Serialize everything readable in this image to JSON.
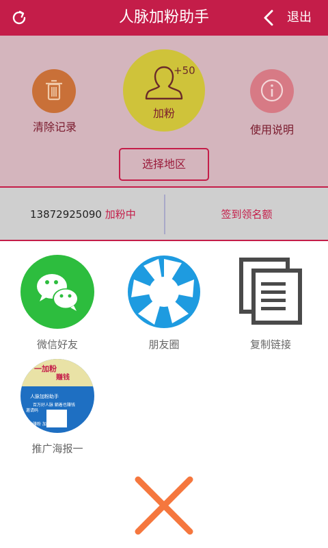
{
  "app": {
    "title": "人脉加粉助手",
    "exit_label": "退出"
  },
  "panel": {
    "clear_label": "清除记录",
    "add_label": "加粉",
    "add_badge": "+50",
    "help_label": "使用说明",
    "region_button": "选择地区"
  },
  "status": {
    "phone": "13872925090",
    "phone_state": "加粉中",
    "sign_label": "签到领名额"
  },
  "share": {
    "items": [
      {
        "label": "微信好友",
        "icon": "wechat-icon"
      },
      {
        "label": "朋友圈",
        "icon": "moments-icon"
      },
      {
        "label": "复制链接",
        "icon": "copy-link-icon"
      },
      {
        "label": "推广海报一",
        "icon": "poster-thumbnail"
      }
    ]
  },
  "poster": {
    "line1": "一加粉",
    "line2": "赚钱",
    "line3": "人脉加粉助手",
    "line4": "百万好人脉  躺着也赚钱",
    "line5": "邀请码",
    "line6": "自动赚粉  加到手软"
  },
  "colors": {
    "accent": "#c41d49",
    "wechat": "#2dbd3e",
    "moments": "#1e9be0",
    "close": "#f5773e"
  }
}
